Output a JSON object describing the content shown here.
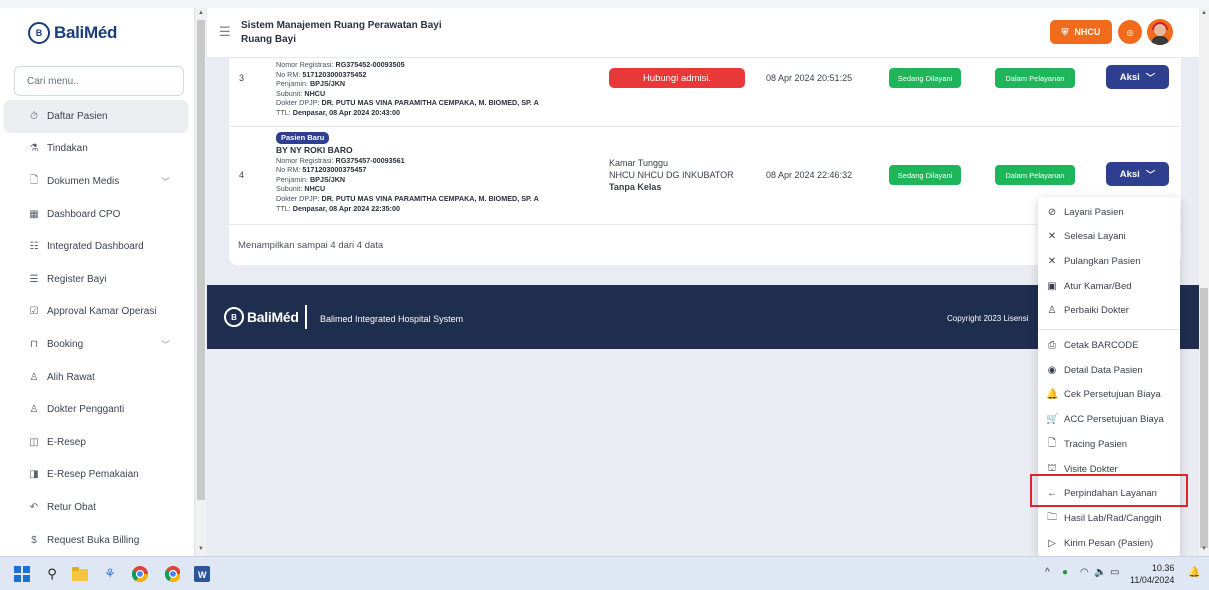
{
  "sidebar": {
    "logo_text": "BaliMéd",
    "search_placeholder": "Cari menu..",
    "items": [
      {
        "label": "Daftar Pasien",
        "icon": "⏱",
        "active": true,
        "chevron": ""
      },
      {
        "label": "Tindakan",
        "icon": "⚗",
        "active": false,
        "chevron": ""
      },
      {
        "label": "Dokumen Medis",
        "icon": "🗋",
        "active": false,
        "chevron": "﹀"
      },
      {
        "label": "Dashboard CPO",
        "icon": "▦",
        "active": false,
        "chevron": ""
      },
      {
        "label": "Integrated Dashboard",
        "icon": "☷",
        "active": false,
        "chevron": ""
      },
      {
        "label": "Register Bayi",
        "icon": "☰",
        "active": false,
        "chevron": ""
      },
      {
        "label": "Approval Kamar Operasi",
        "icon": "☑",
        "active": false,
        "chevron": ""
      },
      {
        "label": "Booking",
        "icon": "⊓",
        "active": false,
        "chevron": "﹀"
      },
      {
        "label": "Alih Rawat",
        "icon": "♙",
        "active": false,
        "chevron": ""
      },
      {
        "label": "Dokter Pengganti",
        "icon": "♙",
        "active": false,
        "chevron": ""
      },
      {
        "label": "E-Resep",
        "icon": "◫",
        "active": false,
        "chevron": ""
      },
      {
        "label": "E-Resep Pemakaian",
        "icon": "◨",
        "active": false,
        "chevron": ""
      },
      {
        "label": "Retur Obat",
        "icon": "↶",
        "active": false,
        "chevron": ""
      },
      {
        "label": "Request Buka Billing",
        "icon": "$",
        "active": false,
        "chevron": ""
      }
    ]
  },
  "header": {
    "title": "Sistem Manajemen Ruang Perawatan Bayi",
    "subtitle": "Ruang Bayi",
    "unit_button": "NHCU"
  },
  "rows": [
    {
      "num": "3",
      "badge": "",
      "name": "",
      "registrasi_label": "Nomor Registrasi: ",
      "registrasi": "RG375452-00093505",
      "rm_label": "No RM: ",
      "rm": "5171203000375452",
      "penjamin_label": "Penjamin: ",
      "penjamin": "BPJS/JKN",
      "subunit_label": "Subunit: ",
      "subunit": "NHCU",
      "dpjp_label": "Dokter DPJP: ",
      "dpjp": "DR. PUTU MAS VINA PARAMITHA CEMPAKA, M. BIOMED, SP. A",
      "ttl_label": "TTL: ",
      "ttl": "Denpasar, 08 Apr 2024 20:43:00",
      "kamar_alert": "Hubungi admisi.",
      "kamar_line1": "",
      "kamar_line2": "",
      "kamar_kelas": "",
      "datetime": "08 Apr 2024 20:51:25",
      "status1": "Sedang Dilayani",
      "status2": "Dalam Pelayanan",
      "aksi": "Aksi"
    },
    {
      "num": "4",
      "badge": "Pasien Baru",
      "name": "BY NY ROKI BARO",
      "registrasi_label": "Nomor Registrasi: ",
      "registrasi": "RG375457-00093561",
      "rm_label": "No RM: ",
      "rm": "5171203000375457",
      "penjamin_label": "Penjamin: ",
      "penjamin": "BPJS/JKN",
      "subunit_label": "Subunit: ",
      "subunit": "NHCU",
      "dpjp_label": "Dokter DPJP: ",
      "dpjp": "DR. PUTU MAS VINA PARAMITHA CEMPAKA, M. BIOMED, SP. A",
      "ttl_label": "TTL: ",
      "ttl": "Denpasar, 08 Apr 2024 22:35:00",
      "kamar_alert": "",
      "kamar_line1": "Kamar Tunggu",
      "kamar_line2": "NHCU NHCU DG INKUBATOR",
      "kamar_kelas": "Tanpa Kelas",
      "datetime": "08 Apr 2024 22:46:32",
      "status1": "Sedang Dilayani",
      "status2": "Dalam Pelayanan",
      "aksi": "Aksi"
    }
  ],
  "table_footer": "Menampilkan sampai 4 dari 4 data",
  "footer": {
    "title": "Balimed Integrated Hospital System",
    "copyright": "Copyright 2023 Lisensi"
  },
  "dropdown": {
    "group1": [
      {
        "label": "Layani Pasien",
        "icon": "⊘"
      },
      {
        "label": "Selesai Layani",
        "icon": "✕"
      },
      {
        "label": "Pulangkan Pasien",
        "icon": "✕"
      },
      {
        "label": "Atur Kamar/Bed",
        "icon": "▣"
      },
      {
        "label": "Perbaiki Dokter",
        "icon": "♙"
      }
    ],
    "group2": [
      {
        "label": "Cetak BARCODE",
        "icon": "⎙"
      },
      {
        "label": "Detail Data Pasien",
        "icon": "◉"
      },
      {
        "label": "Cek Persetujuan Biaya",
        "icon": "🔔"
      },
      {
        "label": "ACC Persetujuan Biaya",
        "icon": "🛒"
      },
      {
        "label": "Tracing Pasien",
        "icon": "🗋"
      },
      {
        "label": "Visite Dokter",
        "icon": "⛫"
      },
      {
        "label": "Perpindahan Layanan",
        "icon": "←"
      },
      {
        "label": "Hasil Lab/Rad/Canggih",
        "icon": "🗀"
      },
      {
        "label": "Kirim Pesan (Pasien)",
        "icon": "▷"
      }
    ]
  },
  "taskbar": {
    "time": "10.36",
    "date": "11/04/2024"
  },
  "colors": {
    "brand_navy": "#1f2e4f",
    "accent_orange": "#f26b1d",
    "status_green": "#1fb55a",
    "alert_red": "#e8383a",
    "aksi_blue": "#2f3f8f",
    "highlight": "#e0242a"
  }
}
